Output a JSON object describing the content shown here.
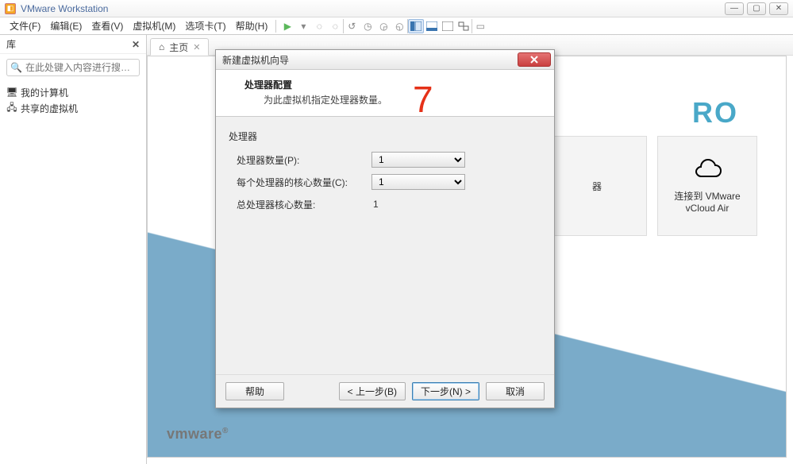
{
  "titlebar": {
    "app_name": "VMware Workstation"
  },
  "menu": {
    "items": [
      "文件(F)",
      "编辑(E)",
      "查看(V)",
      "虚拟机(M)",
      "选项卡(T)",
      "帮助(H)"
    ]
  },
  "sidebar": {
    "header": "库",
    "search_placeholder": "在此处键入内容进行搜…",
    "tree": [
      {
        "icon": "computer-icon",
        "label": "我的计算机"
      },
      {
        "icon": "shared-vm-icon",
        "label": "共享的虚拟机"
      }
    ]
  },
  "tabs": [
    {
      "icon": "home-icon",
      "label": "主页"
    }
  ],
  "home": {
    "pro_label": "RO",
    "tile1_label": "器",
    "tile2_label": "连接到 VMware vCloud Air",
    "logo": "vmware"
  },
  "dialog": {
    "title": "新建虚拟机向导",
    "header_title": "处理器配置",
    "header_sub": "为此虚拟机指定处理器数量。",
    "group_label": "处理器",
    "fields": {
      "count_label": "处理器数量(P):",
      "count_value": "1",
      "cores_label": "每个处理器的核心数量(C):",
      "cores_value": "1",
      "total_label": "总处理器核心数量:",
      "total_value": "1"
    },
    "buttons": {
      "help": "帮助",
      "back": "< 上一步(B)",
      "next": "下一步(N) >",
      "cancel": "取消"
    }
  },
  "annotation": {
    "seven": "7"
  }
}
